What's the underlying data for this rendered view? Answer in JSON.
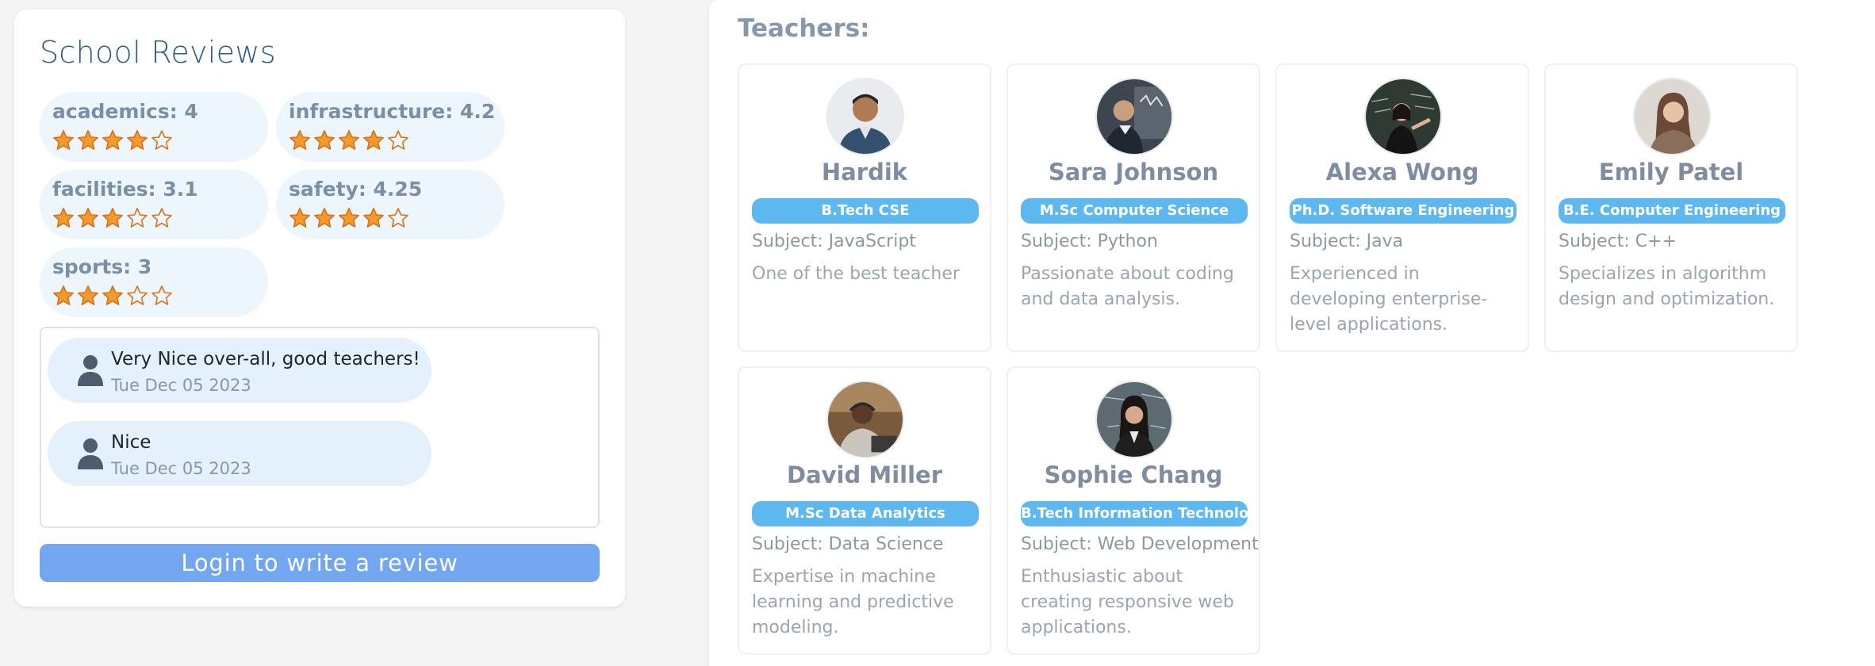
{
  "reviews": {
    "title": "School Reviews",
    "ratings": [
      {
        "label": "academics: 4",
        "value": 4
      },
      {
        "label": "infrastructure: 4.2",
        "value": 4.2
      },
      {
        "label": "facilities: 3.1",
        "value": 3.1
      },
      {
        "label": "safety: 4.25",
        "value": 4.25
      },
      {
        "label": "sports: 3",
        "value": 3
      }
    ],
    "star_max": 5,
    "comments": [
      {
        "text": "Very Nice over-all, good teachers!",
        "date": "Tue Dec 05 2023",
        "icon": "user-icon"
      },
      {
        "text": "Nice",
        "date": "Tue Dec 05 2023",
        "icon": "user-icon"
      }
    ],
    "login_label": "Login to write a review"
  },
  "teachers": {
    "title": "Teachers:",
    "items": [
      {
        "name": "Hardik",
        "degree": "B.Tech CSE",
        "subject": "Subject: JavaScript",
        "description": "One of the best teacher"
      },
      {
        "name": "Sara Johnson",
        "degree": "M.Sc Computer Science",
        "subject": "Subject: Python",
        "description": "Passionate about coding and data analysis."
      },
      {
        "name": "Alexa Wong",
        "degree": "Ph.D. Software Engineering",
        "subject": "Subject: Java",
        "description": "Experienced in developing enterprise-level applications."
      },
      {
        "name": "Emily Patel",
        "degree": "B.E. Computer Engineering",
        "subject": "Subject: C++",
        "description": "Specializes in algorithm design and optimization."
      },
      {
        "name": "David Miller",
        "degree": "M.Sc Data Analytics",
        "subject": "Subject: Data Science",
        "description": "Expertise in machine learning and predictive modeling."
      },
      {
        "name": "Sophie Chang",
        "degree": "B.Tech Information Technology",
        "subject": "Subject: Web Development",
        "description": "Enthusiastic about creating responsive web applications."
      }
    ]
  },
  "colors": {
    "star_fill": "#f39a2e",
    "star_stroke": "#d9731a",
    "badge": "#5cb8ef",
    "login_button": "#72a6ef",
    "title_blue": "#2c5d8a"
  }
}
